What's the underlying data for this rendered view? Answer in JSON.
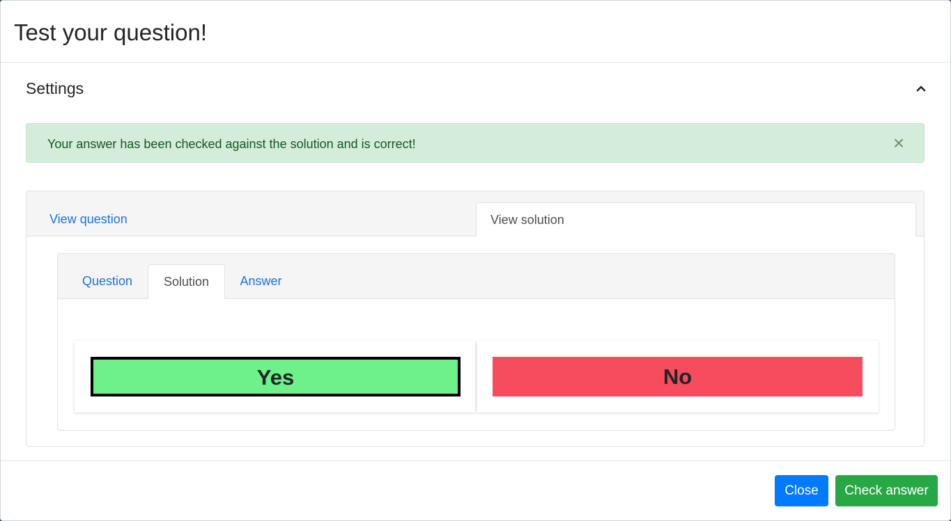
{
  "modal": {
    "title": "Test your question!"
  },
  "settings": {
    "title": "Settings",
    "toggle_icon": "chevron-up-icon"
  },
  "alert": {
    "message": "Your answer has been checked against the solution and is correct!",
    "close_glyph": "×",
    "type": "success"
  },
  "outer_tabs": [
    {
      "label": "View question",
      "active": false
    },
    {
      "label": "View solution",
      "active": true
    }
  ],
  "inner_tabs": [
    {
      "label": "Question",
      "active": false
    },
    {
      "label": "Solution",
      "active": true
    },
    {
      "label": "Answer",
      "active": false
    }
  ],
  "options": [
    {
      "label": "Yes",
      "color": "#6ef08a",
      "selected": true
    },
    {
      "label": "No",
      "color": "#f64c5d",
      "selected": false
    }
  ],
  "footer": {
    "close_label": "Close",
    "check_label": "Check answer"
  },
  "colors": {
    "primary": "#007bff",
    "success": "#28a745",
    "alert_bg": "#d4edda",
    "link": "#1a73e8"
  }
}
